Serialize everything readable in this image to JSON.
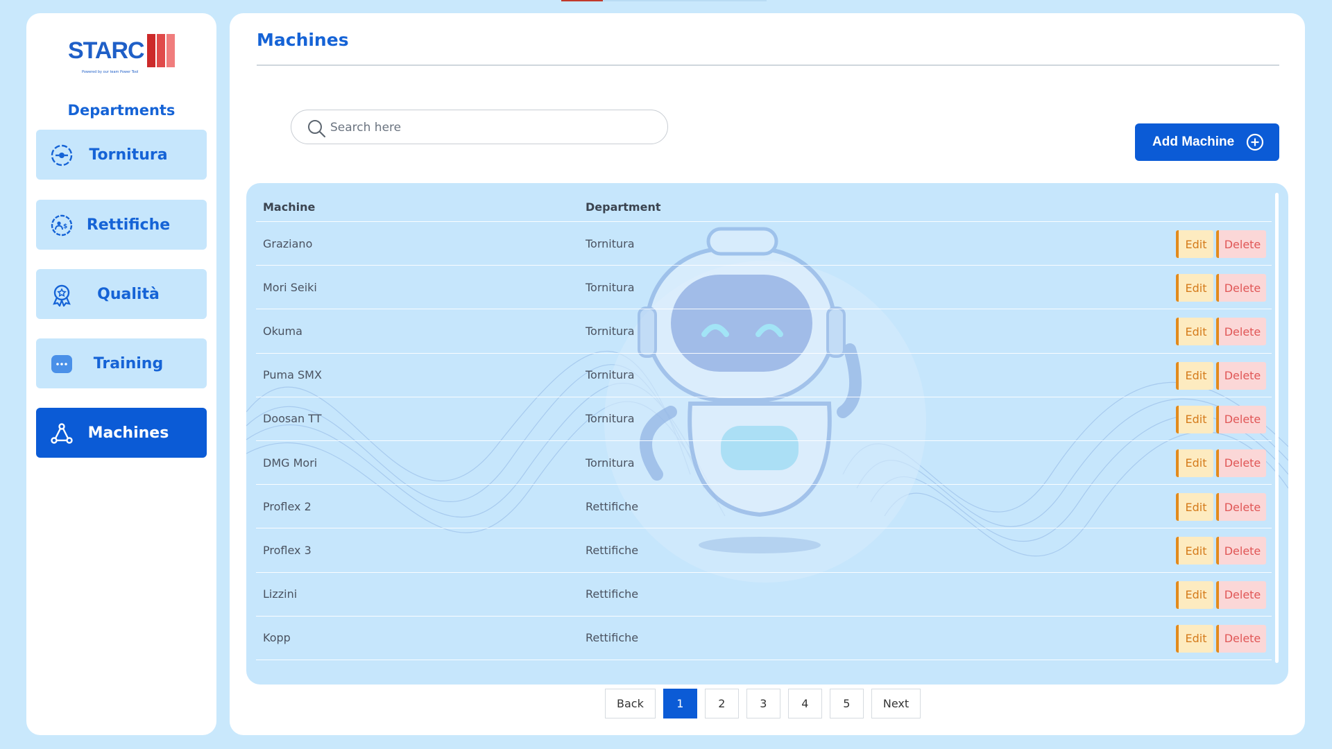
{
  "app": {
    "logo_text": "STARC",
    "logo_tagline": "Powered by our team Power Tool"
  },
  "sidebar": {
    "heading": "Departments",
    "items": [
      {
        "label": "Tornitura",
        "icon": "circle-target-icon",
        "active": false
      },
      {
        "label": "Rettifiche",
        "icon": "gear-people-icon",
        "active": false
      },
      {
        "label": "Qualità",
        "icon": "award-badge-icon",
        "active": false
      },
      {
        "label": "Training",
        "icon": "chat-dots-icon",
        "active": false
      },
      {
        "label": "Machines",
        "icon": "network-nodes-icon",
        "active": true
      }
    ]
  },
  "main": {
    "title": "Machines",
    "search_placeholder": "Search here",
    "add_button": "Add Machine",
    "table": {
      "headers": [
        "Machine",
        "Department"
      ],
      "rows": [
        {
          "machine": "Graziano",
          "department": "Tornitura"
        },
        {
          "machine": "Mori Seiki",
          "department": "Tornitura"
        },
        {
          "machine": "Okuma",
          "department": "Tornitura"
        },
        {
          "machine": "Puma SMX",
          "department": "Tornitura"
        },
        {
          "machine": "Doosan TT",
          "department": "Tornitura"
        },
        {
          "machine": "DMG Mori",
          "department": "Tornitura"
        },
        {
          "machine": "Proflex 2",
          "department": "Rettifiche"
        },
        {
          "machine": "Proflex 3",
          "department": "Rettifiche"
        },
        {
          "machine": "Lizzini",
          "department": "Rettifiche"
        },
        {
          "machine": "Kopp",
          "department": "Rettifiche"
        }
      ],
      "edit_label": "Edit",
      "delete_label": "Delete"
    },
    "pagination": {
      "back": "Back",
      "pages": [
        "1",
        "2",
        "3",
        "4",
        "5"
      ],
      "current": "1",
      "next": "Next"
    }
  },
  "colors": {
    "accent": "#0b5bd6",
    "background": "#c9e8fc",
    "edit_bg": "#fdebc0",
    "delete_bg": "#fbd7d7"
  }
}
